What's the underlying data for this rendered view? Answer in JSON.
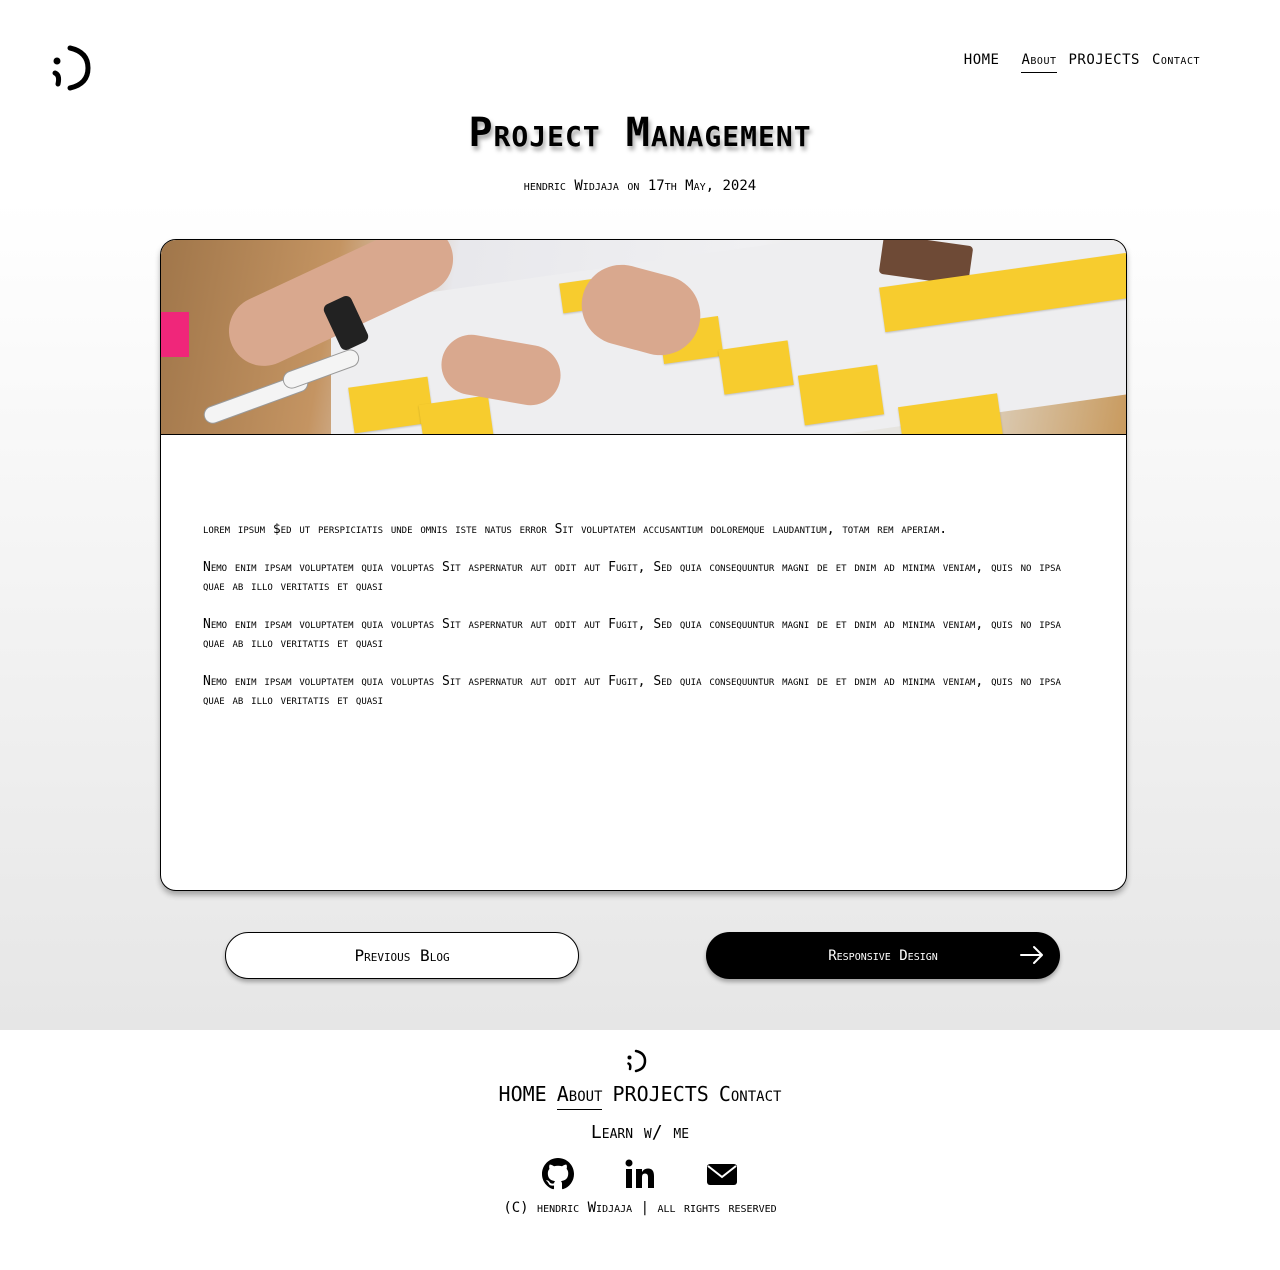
{
  "header": {
    "logo_icon": "semicolon-smile-logo-icon",
    "nav": [
      {
        "label": "HOME",
        "active": false
      },
      {
        "label": "About",
        "active": true
      },
      {
        "label": "PROJECTS",
        "active": false
      },
      {
        "label": "Contact",
        "active": false
      }
    ]
  },
  "article": {
    "title": "Project Management",
    "byline": "hendric Widjaja on 17th May, 2024",
    "hero_image": "sticky-notes-planning-board-photo",
    "paragraphs": [
      "lorem ipsum $ed ut perspiciatis unde omnis iste natus error Sit voluptatem accusantium doloremque laudantium, totam rem aperiam.",
      " Nemo enim ipsam voluptatem quia voluptas Sit aspernatur aut odit aut Fugit, Sed quia consequuntur magni de et dnim ad minima veniam, quis no ipsa quae ab illo  veritatis et quasi",
      " Nemo enim ipsam voluptatem quia voluptas Sit aspernatur aut odit aut Fugit, Sed quia consequuntur magni de et dnim ad minima veniam, quis no ipsa quae ab illo  veritatis et quasi",
      " Nemo enim ipsam voluptatem quia voluptas Sit aspernatur aut odit aut Fugit, Sed quia consequuntur magni de et dnim ad minima veniam, quis no ipsa quae ab illo  veritatis et quasi"
    ]
  },
  "pagination": {
    "prev_label": "Previous Blog",
    "next_label": "Responsive Design",
    "next_icon": "arrow-right-icon"
  },
  "footer": {
    "logo_icon": "semicolon-smile-logo-icon",
    "nav": [
      {
        "label": "HOME",
        "active": false
      },
      {
        "label": "About",
        "active": true
      },
      {
        "label": "PROJECTS",
        "active": false
      },
      {
        "label": "Contact",
        "active": false
      }
    ],
    "learn_label": "Learn w/ me",
    "social": [
      "github-icon",
      "linkedin-icon",
      "mail-icon"
    ],
    "copyright": "(C) hendric Widjaja | all rights reserved"
  },
  "colors": {
    "primary": "#000000",
    "background": "#ffffff",
    "gradient_end": "#e6e6e6",
    "note_yellow": "#f7cc2e"
  }
}
